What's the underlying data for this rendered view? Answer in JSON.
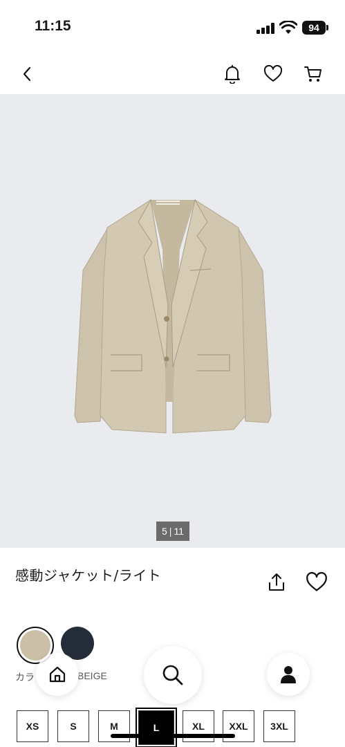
{
  "status_bar": {
    "time": "11:15",
    "battery": "94"
  },
  "nav": {
    "back_icon": "chevron-left-icon",
    "bell_icon": "bell-icon",
    "heart_icon": "heart-icon",
    "cart_icon": "cart-icon"
  },
  "gallery": {
    "current": "5",
    "total": "11",
    "background": "#e9ebee"
  },
  "product": {
    "title": "感動ジャケット/ライト"
  },
  "colors": {
    "label": "カラー：",
    "selected_value": "BEIGE",
    "label_visible": "カラ",
    "swatches": [
      {
        "name": "beige",
        "hex": "#cbbfa8"
      },
      {
        "name": "navy",
        "hex": "#252d3b"
      }
    ]
  },
  "sizes": [
    "XS",
    "S",
    "M",
    "L",
    "XL",
    "XXL",
    "3XL"
  ],
  "selected_size": "L",
  "bottom_nav": {
    "home_icon": "home-icon",
    "search_icon": "search-icon",
    "account_icon": "user-icon"
  }
}
